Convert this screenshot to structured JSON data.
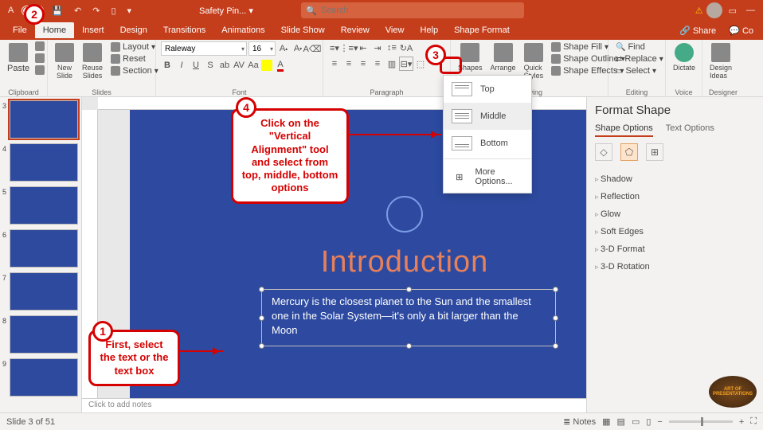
{
  "titlebar": {
    "autosave": "A",
    "docname": "Safety Pin...",
    "search_placeholder": "Search"
  },
  "menubar": {
    "items": [
      "File",
      "Home",
      "Insert",
      "Design",
      "Transitions",
      "Animations",
      "Slide Show",
      "Review",
      "View",
      "Help",
      "Shape Format"
    ],
    "active": 1,
    "share": "Share",
    "comments": "Co"
  },
  "ribbon": {
    "groups": [
      "Clipboard",
      "Slides",
      "Font",
      "Paragraph",
      "Drawing",
      "Editing",
      "Voice",
      "Designer"
    ],
    "clipboard": {
      "paste": "Paste"
    },
    "slides": {
      "new": "New\nSlide",
      "reuse": "Reuse\nSlides",
      "layout": "Layout",
      "reset": "Reset",
      "section": "Section"
    },
    "font": {
      "name": "Raleway",
      "size": "16"
    },
    "drawing": {
      "shapes": "Shapes",
      "arrange": "Arrange",
      "quick": "Quick\nStyles",
      "fill": "Shape Fill",
      "outline": "Shape Outline",
      "effects": "Shape Effects"
    },
    "editing": {
      "find": "Find",
      "replace": "Replace",
      "select": "Select"
    },
    "voice": {
      "dictate": "Dictate"
    },
    "designer": {
      "design": "Design\nIdeas"
    }
  },
  "dropdown": {
    "top": "Top",
    "middle": "Middle",
    "bottom": "Bottom",
    "more": "More Options..."
  },
  "thumbs": {
    "start": 3,
    "count": 7
  },
  "slide": {
    "title": "Introduction",
    "body": "Mercury is the closest planet to the Sun and the smallest one in the Solar System—it's only a bit larger than the Moon"
  },
  "callouts": {
    "c1": "First, select the text or the text box",
    "c4": "Click on the \"Vertical Alignment\" tool and select from top, middle, bottom options"
  },
  "format_pane": {
    "title": "Format Shape",
    "tab1": "Shape Options",
    "tab2": "Text Options",
    "sections": [
      "Shadow",
      "Reflection",
      "Glow",
      "Soft Edges",
      "3-D Format",
      "3-D Rotation"
    ]
  },
  "status": {
    "slide": "Slide 3 of 51",
    "notes": "Notes",
    "notes_placeholder": "Click to add notes"
  },
  "watermark": "ART OF PRESENTATIONS"
}
